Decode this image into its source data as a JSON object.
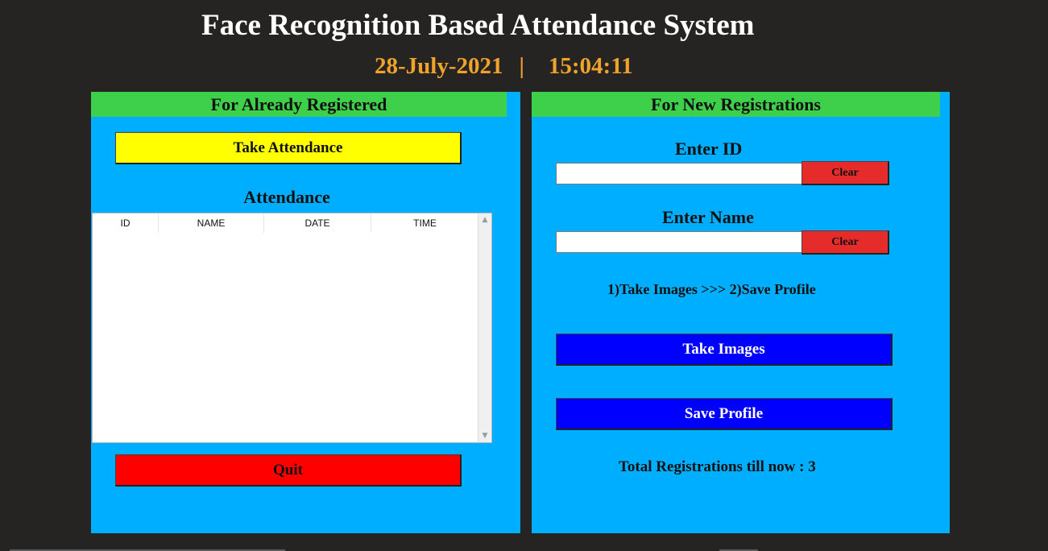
{
  "header": {
    "title": "Face Recognition Based Attendance System",
    "date": "28-July-2021",
    "separator": "|",
    "time": "15:04:11"
  },
  "left_panel": {
    "header": "For Already Registered",
    "take_attendance_label": "Take Attendance",
    "attendance_label": "Attendance",
    "table": {
      "columns": [
        "ID",
        "NAME",
        "DATE",
        "TIME"
      ],
      "rows": []
    },
    "quit_label": "Quit"
  },
  "right_panel": {
    "header": "For New Registrations",
    "enter_id_label": "Enter ID",
    "id_value": "",
    "clear_id_label": "Clear",
    "enter_name_label": "Enter Name",
    "name_value": "",
    "clear_name_label": "Clear",
    "steps_text": "1)Take Images  >>>  2)Save Profile",
    "take_images_label": "Take Images",
    "save_profile_label": "Save Profile",
    "total_text": "Total Registrations till now  : 3"
  },
  "icons": {
    "scroll_up": "chevron-up-icon",
    "scroll_down": "chevron-down-icon"
  },
  "colors": {
    "background": "#262423",
    "panel": "#00aeff",
    "panel_header": "#3ecf4b",
    "take_attendance": "#ffff00",
    "quit": "#ff0000",
    "clear": "#e62b2b",
    "blue_button": "#0000ff",
    "datetime": "#f0a32a"
  }
}
